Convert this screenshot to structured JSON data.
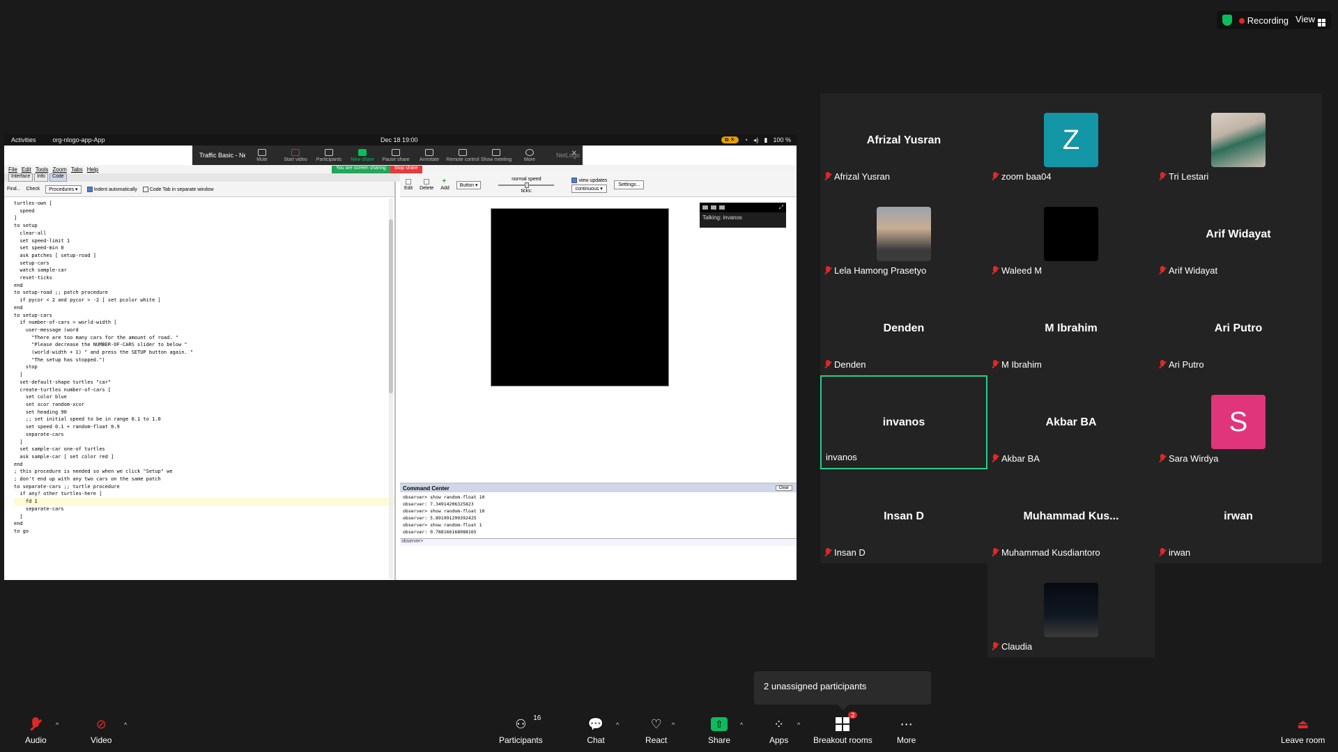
{
  "topbar": {
    "recording_label": "Recording",
    "view_label": "View"
  },
  "shared_screen": {
    "gnome": {
      "activities": "Activities",
      "app_name": "org-nlogo-app-App",
      "clock": "Dec 18  19:00",
      "battery": "100 %"
    },
    "share_toolbar": {
      "window_title": "Traffic Basic - NetL",
      "buttons": [
        "Mute",
        "Start video",
        "Participants",
        "New share",
        "Pause share",
        "Annotate",
        "Remote control",
        "Show meeting",
        "More"
      ],
      "participants_count": "16",
      "more_badge": "3",
      "netlogo_tab": "NetLogo"
    },
    "sharing_pill": {
      "status": "You are screen sharing",
      "stop": "Stop share"
    },
    "netlogo": {
      "menu": [
        "File",
        "Edit",
        "Tools",
        "Zoom",
        "Tabs",
        "Help"
      ],
      "tabs": [
        "Interface",
        "Info",
        "Code"
      ],
      "code_tools": {
        "find": "Find...",
        "check": "Check",
        "procedures": "Procedures",
        "indent": "Indent automatically",
        "separate": "Code Tab in separate window"
      },
      "code_lines": [
        "turtles-own [",
        "  speed",
        "]",
        "",
        "to setup",
        "  clear-all",
        "  set speed-limit 1",
        "  set speed-min 0",
        "  ask patches [ setup-road ]",
        "  setup-cars",
        "  watch sample-car",
        "  reset-ticks",
        "end",
        "",
        "to setup-road ;; patch procedure",
        "  if pycor < 2 and pycor > -2 [ set pcolor white ]",
        "end",
        "",
        "to setup-cars",
        "  if number-of-cars > world-width [",
        "    user-message (word",
        "      \"There are too many cars for the amount of road. \"",
        "      \"Please decrease the NUMBER-OF-CARS slider to below \"",
        "      (world-width + 1) \" and press the SETUP button again. \"",
        "      \"The setup has stopped.\")",
        "    stop",
        "  ]",
        "  set-default-shape turtles \"car\"",
        "  create-turtles number-of-cars [",
        "    set color blue",
        "    set xcor random-xcor",
        "    set heading 90",
        "    ;; set initial speed to be in range 0.1 to 1.0",
        "    set speed 0.1 + random-float 0.9",
        "    separate-cars",
        "  ]",
        "  set sample-car one-of turtles",
        "  ask sample-car [ set color red ]",
        "end",
        "",
        "; this procedure is needed so when we click \"Setup\" we",
        "; don't end up with any two cars on the same patch",
        "to separate-cars ;; turtle procedure",
        "  if any? other turtles-here [",
        "    fd 1",
        "    separate-cars",
        "  ]",
        "end",
        "",
        "to go"
      ],
      "iface_tools": {
        "edit": "Edit",
        "delete": "Delete",
        "add": "Add",
        "widget": "Button",
        "speed": "normal speed",
        "ticks": "ticks:",
        "view_updates": "view updates",
        "update_mode": "continuous",
        "settings": "Settings..."
      },
      "mini_controls": {
        "talking": "Talking: invanos"
      },
      "command_center": {
        "title": "Command Center",
        "clear": "Clear",
        "lines": [
          "observer> show random-float 10",
          "observer: 7.34914206325823",
          "observer> show random-float 10",
          "observer: 5.891991299392425",
          "observer> show random-float 1",
          "observer: 0.788166168088165"
        ],
        "prompt": "observer>"
      }
    }
  },
  "gallery": [
    {
      "display": "Afrizal Yusran",
      "label": "Afrizal Yusran",
      "kind": "name",
      "muted": true
    },
    {
      "display": "Z",
      "label": "zoom baa04",
      "kind": "letter",
      "color": "#1396a6",
      "muted": true
    },
    {
      "display": "",
      "label": "Tri Lestari",
      "kind": "photo1",
      "muted": true
    },
    {
      "display": "",
      "label": "Lela Hamong Prasetyo",
      "kind": "photo2",
      "muted": true
    },
    {
      "display": "",
      "label": "Waleed M",
      "kind": "photo3",
      "muted": true
    },
    {
      "display": "Arif Widayat",
      "label": "Arif Widayat",
      "kind": "name",
      "muted": true
    },
    {
      "display": "Denden",
      "label": "Denden",
      "kind": "name",
      "muted": true
    },
    {
      "display": "M Ibrahim",
      "label": "M Ibrahim",
      "kind": "name",
      "muted": true
    },
    {
      "display": "Ari Putro",
      "label": "Ari Putro",
      "kind": "name",
      "muted": true
    },
    {
      "display": "invanos",
      "label": "invanos",
      "kind": "name",
      "muted": false,
      "active": true
    },
    {
      "display": "Akbar BA",
      "label": "Akbar BA",
      "kind": "name",
      "muted": true
    },
    {
      "display": "S",
      "label": "Sara Wirdya",
      "kind": "letter",
      "color": "#e0357a",
      "muted": true
    },
    {
      "display": "Insan D",
      "label": "Insan D",
      "kind": "name",
      "muted": true
    },
    {
      "display": "Muhammad  Kus...",
      "label": "Muhammad Kusdiantoro",
      "kind": "name",
      "muted": true
    },
    {
      "display": "irwan",
      "label": "irwan",
      "kind": "name",
      "muted": true
    },
    {
      "display": "",
      "label": "Claudia",
      "kind": "photo4",
      "muted": true
    }
  ],
  "unassigned_tip": "2 unassigned participants",
  "toolbar": {
    "audio": "Audio",
    "video": "Video",
    "participants": "Participants",
    "participants_count": "16",
    "chat": "Chat",
    "react": "React",
    "share": "Share",
    "apps": "Apps",
    "breakout": "Breakout rooms",
    "breakout_badge": "2",
    "more": "More",
    "leave": "Leave room"
  }
}
